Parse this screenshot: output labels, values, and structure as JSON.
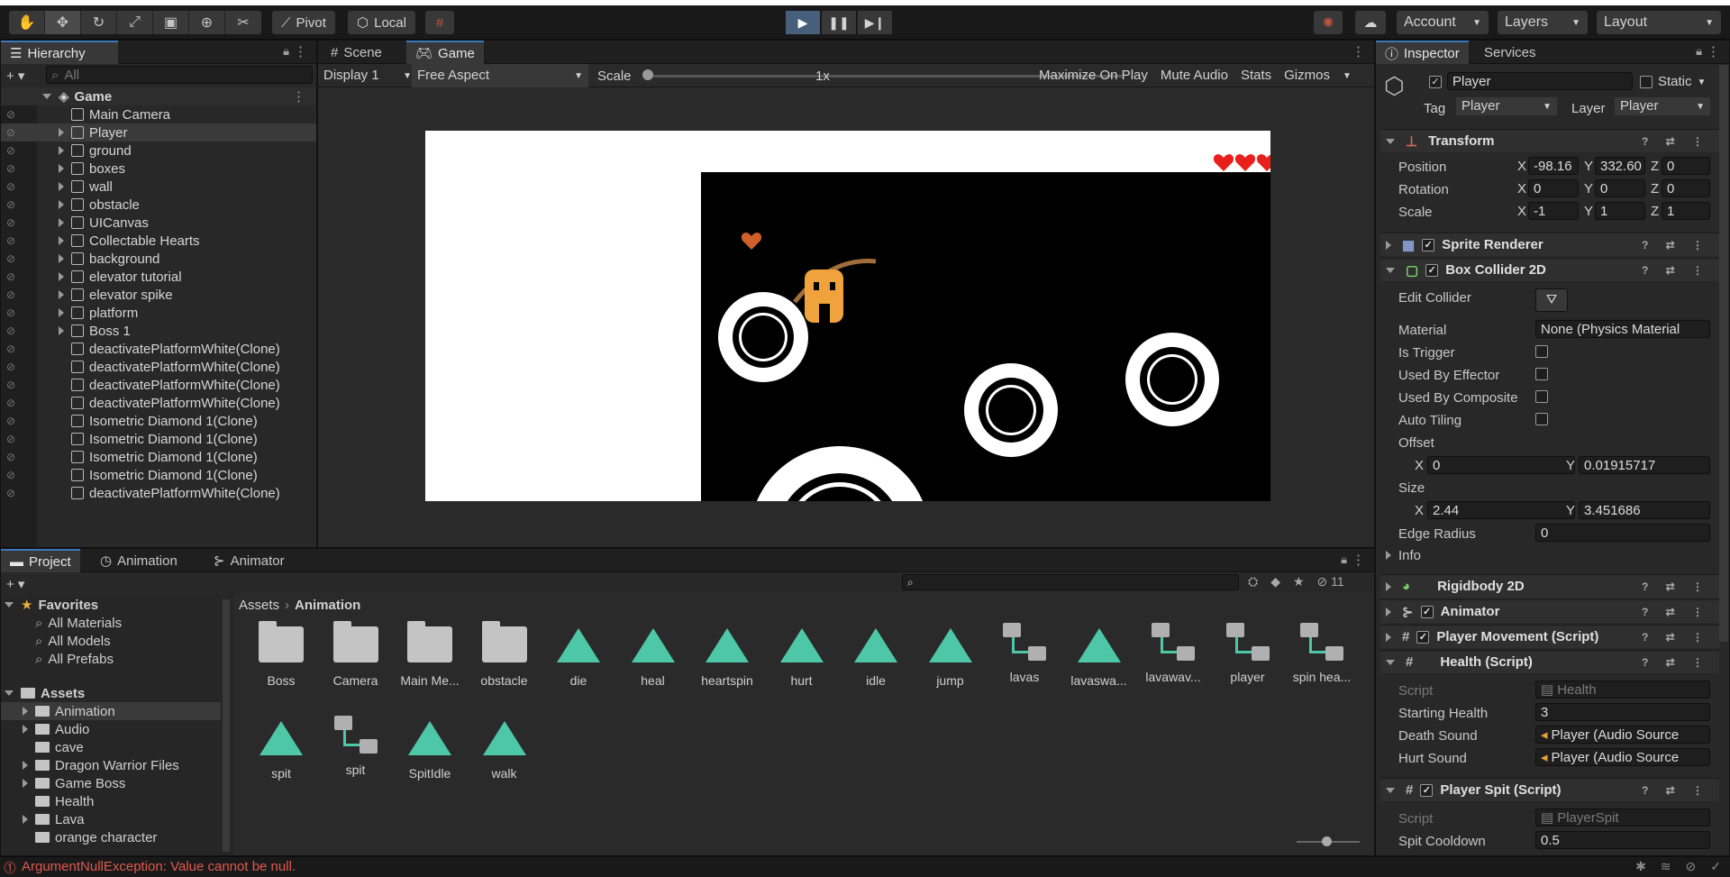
{
  "toolbar": {
    "pivot_label": "Pivot",
    "local_label": "Local",
    "account_label": "Account",
    "layers_label": "Layers",
    "layout_label": "Layout"
  },
  "hierarchy": {
    "tab_label": "Hierarchy",
    "search_placeholder": "All",
    "scene_name": "Game",
    "items": [
      {
        "label": "Main Camera",
        "expandable": false
      },
      {
        "label": "Player",
        "expandable": true,
        "selected": true
      },
      {
        "label": "ground",
        "expandable": true
      },
      {
        "label": "boxes",
        "expandable": true
      },
      {
        "label": "wall",
        "expandable": true
      },
      {
        "label": "obstacle",
        "expandable": true
      },
      {
        "label": "UICanvas",
        "expandable": true
      },
      {
        "label": "Collectable Hearts",
        "expandable": true
      },
      {
        "label": "background",
        "expandable": true
      },
      {
        "label": "elevator tutorial",
        "expandable": true
      },
      {
        "label": "elevator spike",
        "expandable": true
      },
      {
        "label": "platform",
        "expandable": true
      },
      {
        "label": "Boss 1",
        "expandable": true
      },
      {
        "label": "deactivatePlatformWhite(Clone)",
        "expandable": false
      },
      {
        "label": "deactivatePlatformWhite(Clone)",
        "expandable": false
      },
      {
        "label": "deactivatePlatformWhite(Clone)",
        "expandable": false
      },
      {
        "label": "deactivatePlatformWhite(Clone)",
        "expandable": false
      },
      {
        "label": "Isometric Diamond 1(Clone)",
        "expandable": false
      },
      {
        "label": "Isometric Diamond 1(Clone)",
        "expandable": false
      },
      {
        "label": "Isometric Diamond 1(Clone)",
        "expandable": false
      },
      {
        "label": "Isometric Diamond 1(Clone)",
        "expandable": false
      },
      {
        "label": "deactivatePlatformWhite(Clone)",
        "expandable": false
      }
    ]
  },
  "game_view": {
    "tab_scene": "Scene",
    "tab_game": "Game",
    "display": "Display 1",
    "aspect": "Free Aspect",
    "scale_label": "Scale",
    "scale_value": "1x",
    "maximize": "Maximize On Play",
    "mute": "Mute Audio",
    "stats": "Stats",
    "gizmos": "Gizmos"
  },
  "inspector": {
    "tab_inspector": "Inspector",
    "tab_services": "Services",
    "object_name": "Player",
    "static_label": "Static",
    "tag_label": "Tag",
    "tag_value": "Player",
    "layer_label": "Layer",
    "layer_value": "Player",
    "transform": {
      "title": "Transform",
      "position_label": "Position",
      "pos_x": "-98.16",
      "pos_y": "332.60",
      "pos_z": "0",
      "rotation_label": "Rotation",
      "rot_x": "0",
      "rot_y": "0",
      "rot_z": "0",
      "scale_label": "Scale",
      "scl_x": "-1",
      "scl_y": "1",
      "scl_z": "1"
    },
    "sprite_renderer": "Sprite Renderer",
    "box_collider": {
      "title": "Box Collider 2D",
      "edit_collider": "Edit Collider",
      "material_label": "Material",
      "material_value": "None (Physics Material",
      "is_trigger": "Is Trigger",
      "used_by_effector": "Used By Effector",
      "used_by_composite": "Used By Composite",
      "auto_tiling": "Auto Tiling",
      "offset_label": "Offset",
      "offset_x": "0",
      "offset_y": "0.01915717",
      "size_label": "Size",
      "size_x": "2.44",
      "size_y": "3.451686",
      "edge_radius_label": "Edge Radius",
      "edge_radius": "0",
      "info_label": "Info"
    },
    "rigidbody": "Rigidbody 2D",
    "animator": "Animator",
    "player_movement": "Player Movement (Script)",
    "health": {
      "title": "Health (Script)",
      "script_label": "Script",
      "script_value": "Health",
      "starting_health_label": "Starting Health",
      "starting_health": "3",
      "death_sound_label": "Death Sound",
      "death_sound": "Player (Audio Source",
      "hurt_sound_label": "Hurt Sound",
      "hurt_sound": "Player (Audio Source"
    },
    "player_spit": {
      "title": "Player Spit (Script)",
      "script_label": "Script",
      "script_value": "PlayerSpit",
      "spit_cooldown_label": "Spit Cooldown",
      "spit_cooldown": "0.5"
    }
  },
  "project": {
    "tab_project": "Project",
    "tab_animation": "Animation",
    "tab_animator": "Animator",
    "hidden_count": "11",
    "favorites_label": "Favorites",
    "favorites": [
      "All Materials",
      "All Models",
      "All Prefabs"
    ],
    "assets_label": "Assets",
    "folders": [
      {
        "label": "Animation",
        "expandable": true,
        "selected": true
      },
      {
        "label": "Audio",
        "expandable": true
      },
      {
        "label": "cave",
        "expandable": false
      },
      {
        "label": "Dragon Warrior Files",
        "expandable": true
      },
      {
        "label": "Game Boss",
        "expandable": true
      },
      {
        "label": "Health",
        "expandable": false
      },
      {
        "label": "Lava",
        "expandable": true
      },
      {
        "label": "orange character",
        "expandable": false
      }
    ],
    "breadcrumb_root": "Assets",
    "breadcrumb_current": "Animation",
    "assets": [
      {
        "label": "Boss",
        "kind": "folder"
      },
      {
        "label": "Camera",
        "kind": "folder"
      },
      {
        "label": "Main Me...",
        "kind": "folder"
      },
      {
        "label": "obstacle",
        "kind": "folder"
      },
      {
        "label": "die",
        "kind": "anim"
      },
      {
        "label": "heal",
        "kind": "anim"
      },
      {
        "label": "heartspin",
        "kind": "anim"
      },
      {
        "label": "hurt",
        "kind": "anim"
      },
      {
        "label": "idle",
        "kind": "anim"
      },
      {
        "label": "jump",
        "kind": "anim"
      },
      {
        "label": "lavas",
        "kind": "controller"
      },
      {
        "label": "lavaswa...",
        "kind": "anim"
      },
      {
        "label": "lavawav...",
        "kind": "controller"
      },
      {
        "label": "player",
        "kind": "controller"
      },
      {
        "label": "spin hea...",
        "kind": "controller"
      },
      {
        "label": "spit",
        "kind": "anim"
      },
      {
        "label": "spit",
        "kind": "controller"
      },
      {
        "label": "SpitIdle",
        "kind": "anim"
      },
      {
        "label": "walk",
        "kind": "anim"
      }
    ]
  },
  "status": {
    "error": "ArgumentNullException: Value cannot be null."
  },
  "colors": {
    "accent": "#3a79bb",
    "anim_teal": "#4ec7a8",
    "error_red": "#e05a4f",
    "player_orange": "#f0a33c"
  }
}
